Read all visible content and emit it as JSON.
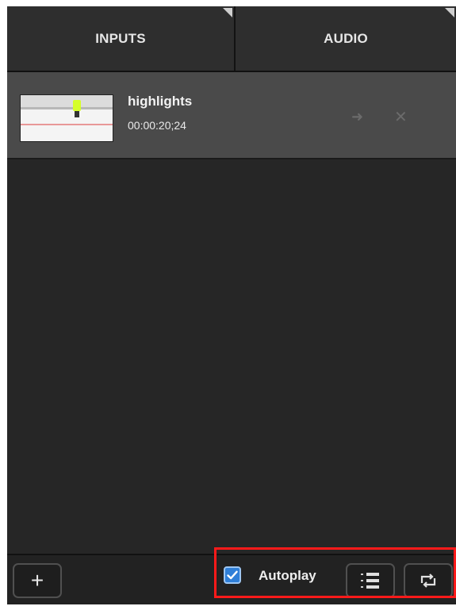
{
  "tabs": [
    {
      "label": "INPUTS"
    },
    {
      "label": "AUDIO"
    }
  ],
  "inputs": [
    {
      "title": "highlights",
      "duration": "00:00:20;24",
      "thumbnail": "hockey-rink-icon"
    }
  ],
  "footer": {
    "add_label": "+",
    "autoplay_label": "Autoplay",
    "autoplay_checked": true,
    "playlist_icon": "list-icon",
    "loop_icon": "repeat-icon"
  },
  "colors": {
    "background": "#262626",
    "item_background": "#4a4a4a",
    "highlight": "#ff1a1a",
    "checkbox": "#2f7fd8"
  }
}
